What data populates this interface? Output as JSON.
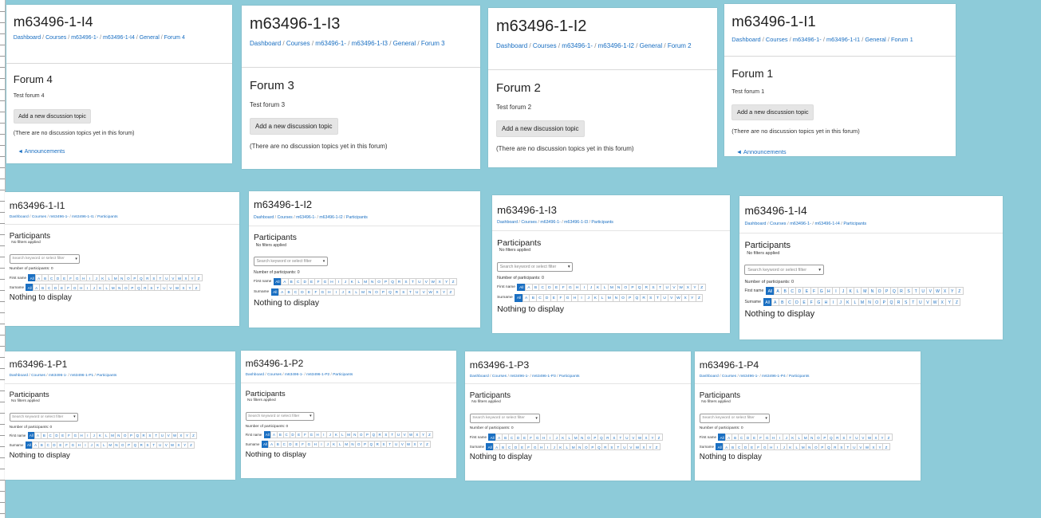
{
  "forum_windows": [
    {
      "title": "m63496-1-I4",
      "crumbs": [
        "Dashboard",
        "Courses",
        "m63496-1-",
        "m63496-1-I4",
        "General",
        "Forum 4"
      ],
      "forum": "Forum 4",
      "desc": "Test forum 4",
      "button": "Add a new discussion topic",
      "empty": "(There are no discussion topics yet in this forum)",
      "footer_link": "◄ Announcements"
    },
    {
      "title": "m63496-1-I3",
      "crumbs": [
        "Dashboard",
        "Courses",
        "m63496-1-",
        "m63496-1-I3",
        "General",
        "Forum 3"
      ],
      "forum": "Forum 3",
      "desc": "Test forum 3",
      "button": "Add a new discussion topic",
      "empty": "(There are no discussion topics yet in this forum)"
    },
    {
      "title": "m63496-1-I2",
      "crumbs": [
        "Dashboard",
        "Courses",
        "m63496-1-",
        "m63496-1-I2",
        "General",
        "Forum 2"
      ],
      "forum": "Forum 2",
      "desc": "Test forum 2",
      "button": "Add a new discussion topic",
      "empty": "(There are no discussion topics yet in this forum)"
    },
    {
      "title": "m63496-1-I1",
      "crumbs": [
        "Dashboard",
        "Courses",
        "m63496-1-",
        "m63496-1-I1",
        "General",
        "Forum 1"
      ],
      "forum": "Forum 1",
      "desc": "Test forum 1",
      "button": "Add a new discussion topic",
      "empty": "(There are no discussion topics yet in this forum)",
      "footer_link": "◄ Announcements"
    }
  ],
  "participant_windows": [
    {
      "title": "m63496-1-I1",
      "crumbs": [
        "Dashboard",
        "Courses",
        "m63496-1-",
        "m63496-1-I1",
        "Participants"
      ]
    },
    {
      "title": "m63496-1-I2",
      "crumbs": [
        "Dashboard",
        "Courses",
        "m63496-1-",
        "m63496-1-I2",
        "Participants"
      ]
    },
    {
      "title": "m63496-1-I3",
      "crumbs": [
        "Dashboard",
        "Courses",
        "m63496-1-",
        "m63496-1-I3",
        "Participants"
      ]
    },
    {
      "title": "m63496-1-I4",
      "crumbs": [
        "Dashboard",
        "Courses",
        "m63496-1-",
        "m63496-1-I4",
        "Participants"
      ]
    },
    {
      "title": "m63496-1-P1",
      "crumbs": [
        "Dashboard",
        "Courses",
        "m63496-1-",
        "m63496-1-P1",
        "Participants"
      ]
    },
    {
      "title": "m63496-1-P2",
      "crumbs": [
        "Dashboard",
        "Courses",
        "m63496-1-",
        "m63496-1-P2",
        "Participants"
      ]
    },
    {
      "title": "m63496-1-P3",
      "crumbs": [
        "Dashboard",
        "Courses",
        "m63496-1-",
        "m63496-1-P3",
        "Participants"
      ]
    },
    {
      "title": "m63496-1-P4",
      "crumbs": [
        "Dashboard",
        "Courses",
        "m63496-1-",
        "m63496-1-P4",
        "Participants"
      ]
    }
  ],
  "participants_page": {
    "heading": "Participants",
    "filters_note": "No filters applied",
    "search_placeholder": "Search keyword or select filter",
    "count": "Number of participants: 0",
    "first_name_label": "First name",
    "surname_label": "Surname",
    "all_label": "All",
    "letters": [
      "A",
      "B",
      "C",
      "D",
      "E",
      "F",
      "G",
      "H",
      "I",
      "J",
      "K",
      "L",
      "M",
      "N",
      "O",
      "P",
      "Q",
      "R",
      "S",
      "T",
      "U",
      "V",
      "W",
      "X",
      "Y",
      "Z"
    ],
    "nothing": "Nothing to display"
  },
  "icons": {
    "caret": "caret-down-icon",
    "back": "back-arrow-icon"
  },
  "colors": {
    "background": "#8dcbd9",
    "link": "#1a6fc2",
    "all_button": "#1a6fc2"
  }
}
